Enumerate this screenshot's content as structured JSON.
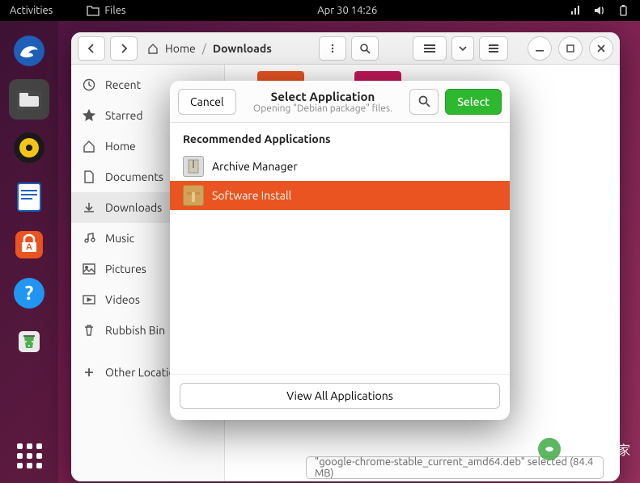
{
  "topbar": {
    "activities": "Activities",
    "app_label": "Files",
    "datetime": "Apr 30  14:26"
  },
  "files": {
    "breadcrumb": {
      "home": "Home",
      "sep": "/",
      "current": "Downloads"
    },
    "sidebar": [
      {
        "label": "Recent",
        "icon": "clock-icon"
      },
      {
        "label": "Starred",
        "icon": "star-icon"
      },
      {
        "label": "Home",
        "icon": "home-icon"
      },
      {
        "label": "Documents",
        "icon": "document-icon"
      },
      {
        "label": "Downloads",
        "icon": "download-icon",
        "active": true
      },
      {
        "label": "Music",
        "icon": "music-icon"
      },
      {
        "label": "Pictures",
        "icon": "picture-icon"
      },
      {
        "label": "Videos",
        "icon": "video-icon"
      },
      {
        "label": "Rubbish Bin",
        "icon": "trash-icon"
      },
      {
        "label": "Other Locations",
        "icon": "plus-icon"
      }
    ],
    "status": "\"google-chrome-stable_current_amd64.deb\" selected  (84.4 MB)"
  },
  "dialog": {
    "cancel": "Cancel",
    "title": "Select Application",
    "subtitle": "Opening \"Debian package\" files.",
    "select": "Select",
    "section": "Recommended Applications",
    "apps": [
      {
        "label": "Archive Manager",
        "selected": false
      },
      {
        "label": "Software Install",
        "selected": true
      }
    ],
    "view_all": "View All Applications"
  },
  "watermark": "微技术之家"
}
